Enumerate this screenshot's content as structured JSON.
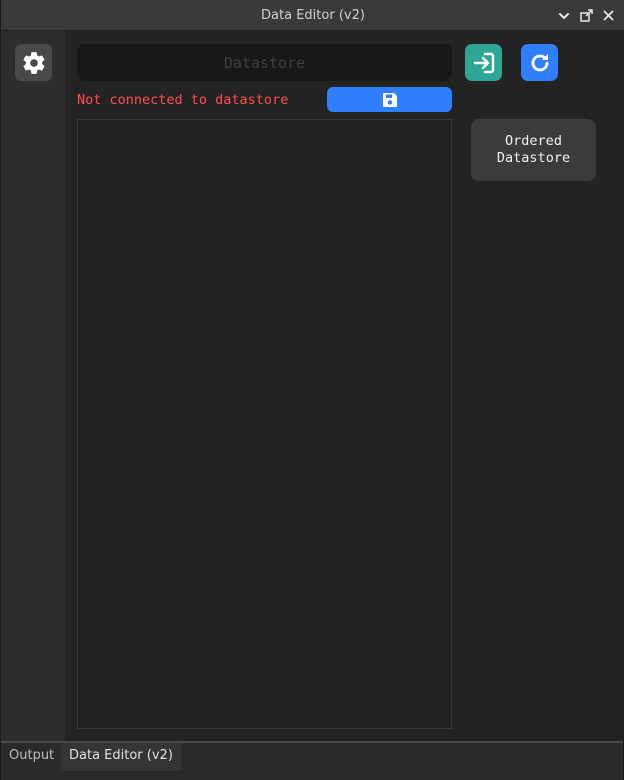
{
  "window": {
    "title": "Data Editor (v2)"
  },
  "titlebar": {
    "controls": [
      "chevron-down-icon",
      "undock-icon",
      "close-icon"
    ]
  },
  "toolbar": {
    "settings_icon": "gear-icon",
    "datastore_input": {
      "value": "",
      "placeholder": "Datastore"
    },
    "status_text": "Not connected to datastore",
    "status_color": "#ff4d4d",
    "save_icon": "floppy-disk-icon",
    "connect_icon": "sign-in-icon",
    "refresh_icon": "refresh-icon",
    "ordered_label": "Ordered\nDatastore"
  },
  "colors": {
    "accent_blue": "#2f7fff",
    "accent_teal": "#2fa595",
    "background": "#232323"
  },
  "tabs": [
    {
      "label": "Output",
      "active": false
    },
    {
      "label": "Data Editor (v2)",
      "active": true
    }
  ]
}
